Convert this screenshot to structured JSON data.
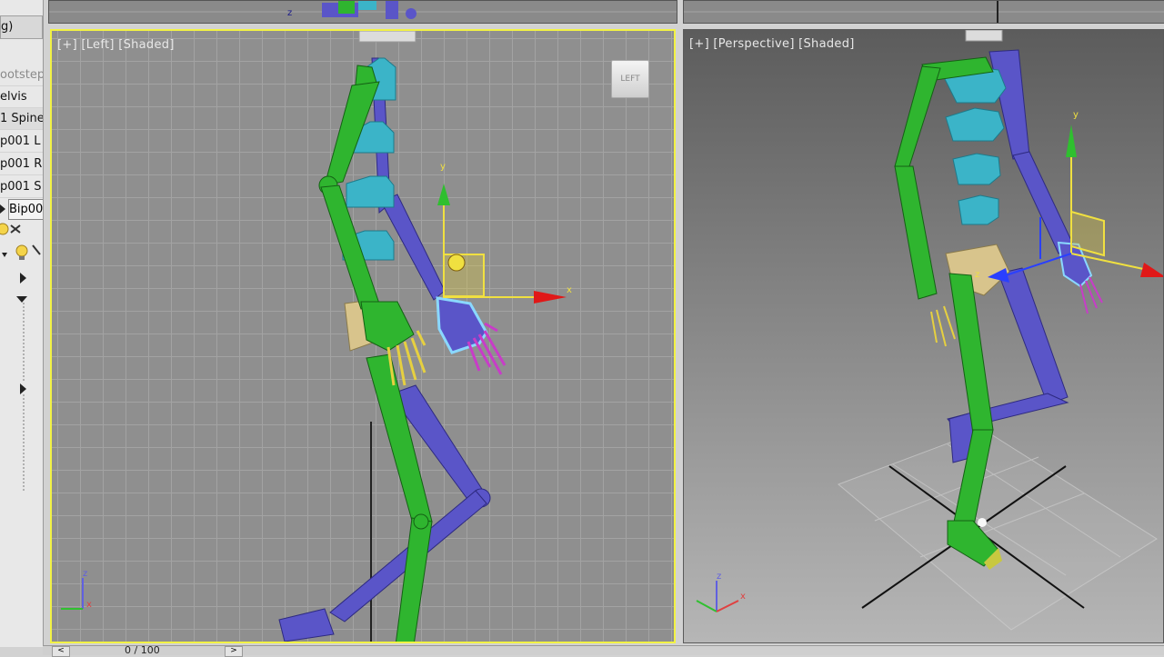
{
  "explorer": {
    "header": "g)",
    "rows": [
      {
        "label": "ootstep",
        "state": "dim"
      },
      {
        "label": "elvis",
        "state": "normal"
      },
      {
        "label": "1 Spine",
        "state": "sel"
      },
      {
        "label": "p001 L",
        "state": "normal"
      },
      {
        "label": "p001 R",
        "state": "normal"
      },
      {
        "label": "p001 S",
        "state": "normal"
      }
    ],
    "tab_label": "Bip00"
  },
  "viewports": {
    "left": {
      "label": "[+] [Left] [Shaded]",
      "viewcube": "LEFT"
    },
    "perspective": {
      "label": "[+] [Perspective] [Shaded]"
    }
  },
  "gizmo": {
    "x_label": "x",
    "y_label": "y",
    "z_label": "z"
  },
  "timebar": {
    "frame": "0 / 100",
    "prev": "<",
    "next": ">"
  },
  "colors": {
    "active_border": "#f2f244",
    "green_biped": "#2fb52f",
    "blue_biped": "#5a55c8",
    "spine": "#3bb4c8",
    "pelvis": "#d8c48c"
  }
}
